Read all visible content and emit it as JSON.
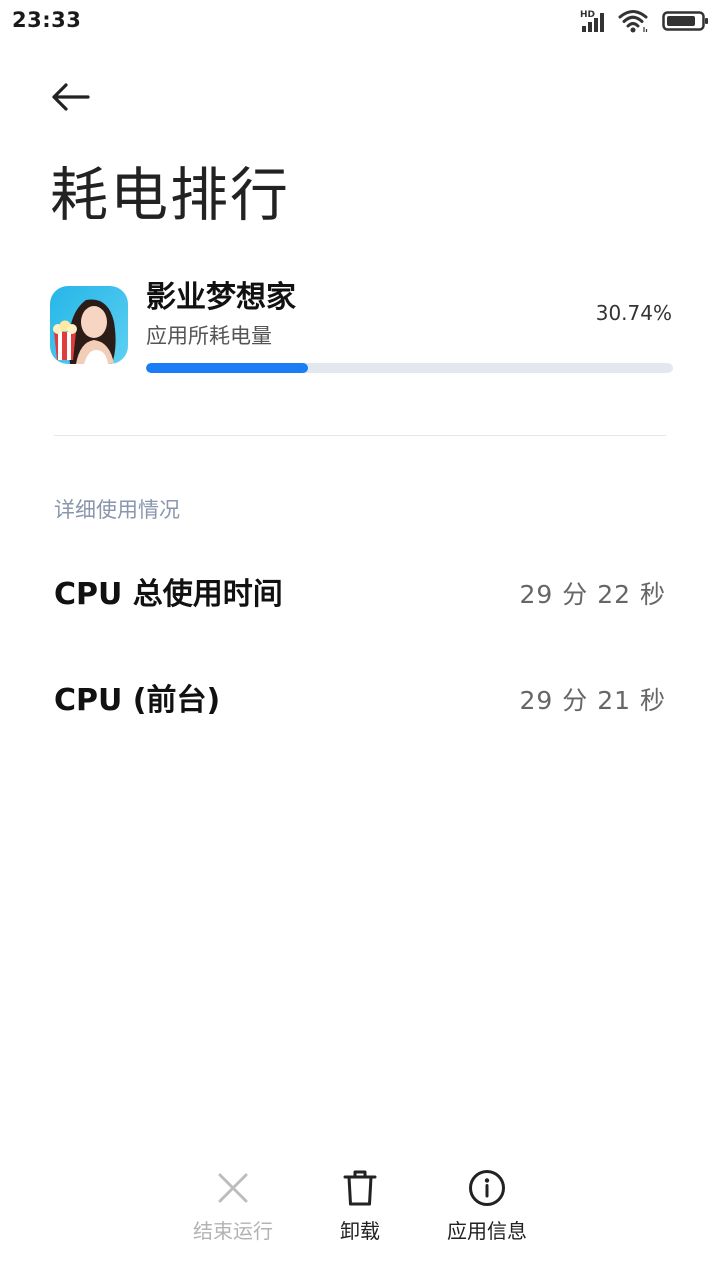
{
  "status_bar": {
    "time": "23:33",
    "icons": [
      "hd-signal-icon",
      "wifi-icon",
      "battery-icon"
    ],
    "signal_badge": "HD"
  },
  "header": {
    "back_icon": "back-arrow-icon",
    "title": "耗电排行"
  },
  "app": {
    "name": "影业梦想家",
    "subtitle": "应用所耗电量",
    "percent_text": "30.74%",
    "percent_value": 0.3074,
    "accent_color": "#1a7df5",
    "track_color": "#e3e7ee"
  },
  "details": {
    "header": "详细使用情况",
    "rows": [
      {
        "label": "CPU 总使用时间",
        "value": "29 分 22 秒"
      },
      {
        "label": "CPU (前台)",
        "value": "29 分 21 秒"
      }
    ]
  },
  "actions": [
    {
      "label": "结束运行",
      "icon": "close-icon",
      "enabled": false
    },
    {
      "label": "卸载",
      "icon": "trash-icon",
      "enabled": true
    },
    {
      "label": "应用信息",
      "icon": "info-icon",
      "enabled": true
    }
  ]
}
